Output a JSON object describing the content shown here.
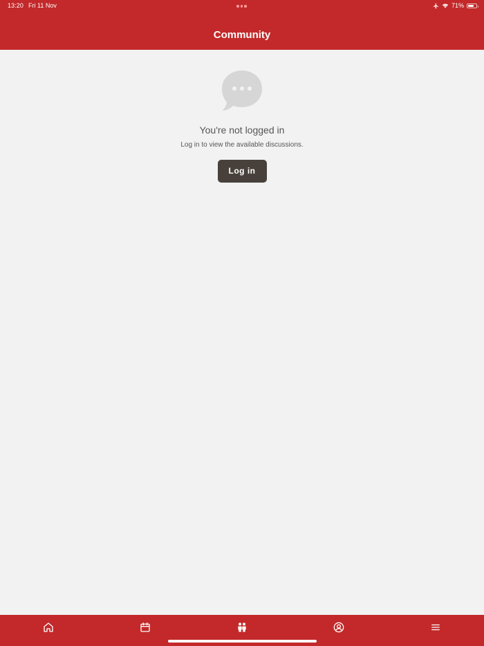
{
  "status_bar": {
    "time": "13:20",
    "date": "Fri 11 Nov",
    "battery_percent": "71%",
    "battery_level": 0.71,
    "icons": [
      "airplane-icon",
      "wifi-icon",
      "battery-icon"
    ]
  },
  "header": {
    "title": "Community"
  },
  "empty_state": {
    "icon": "chat-bubble-icon",
    "title": "You're not logged in",
    "subtitle": "Log in to view the available discussions.",
    "login_label": "Log in"
  },
  "tab_bar": {
    "tabs": [
      {
        "icon": "home-icon"
      },
      {
        "icon": "calendar-icon"
      },
      {
        "icon": "community-icon",
        "active": true
      },
      {
        "icon": "profile-icon"
      },
      {
        "icon": "menu-icon"
      }
    ]
  },
  "colors": {
    "brand": "#c3292a",
    "background": "#f2f2f2",
    "button": "#48413b",
    "text_secondary": "#555555",
    "icon_placeholder": "#d6d6d6"
  }
}
